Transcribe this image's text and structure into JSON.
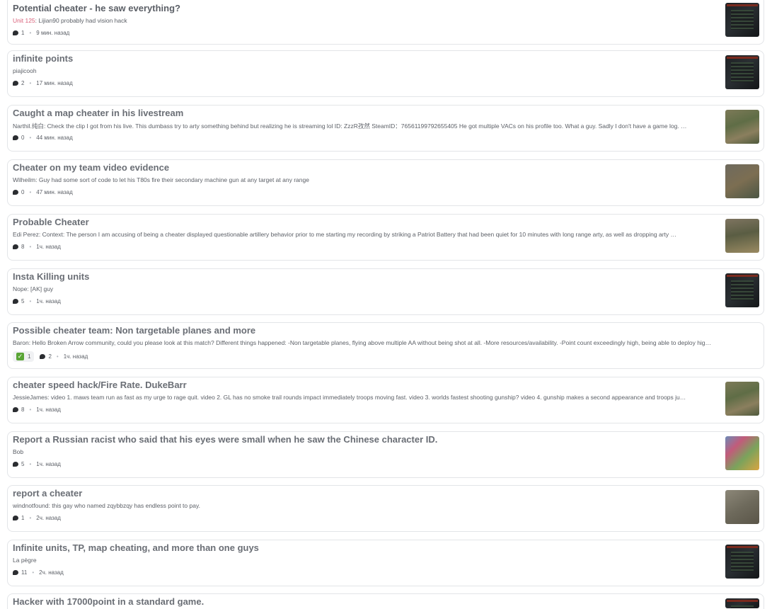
{
  "posts": [
    {
      "title": "Potential cheater - he saw everything?",
      "author": "Unit 125",
      "text": ": Lijian90 probably had vision hack",
      "comments": "1",
      "time": "9 мин. назад"
    },
    {
      "title": "infinite points",
      "author": "piajicooh",
      "text": "",
      "comments": "2",
      "time": "17 мин. назад"
    },
    {
      "title": "Caught a map cheater in his livestream",
      "author": "Narthil.纯白",
      "text": ": Check the clip I got from his live. This dumbass try to arty something behind but realizing he is streaming lol ID: ZzzR孜然 SteamID：76561199792655405 He got multiple VACs on his profile too. What a guy. Sadly I don't have a game log. …",
      "comments": "0",
      "time": "44 мин. назад"
    },
    {
      "title": "Cheater on my team video evidence",
      "author": "Wilheilm",
      "text": ": Guy had some sort of code to let his T80s fire their secondary machine gun at any target at any range",
      "comments": "0",
      "time": "47 мин. назад"
    },
    {
      "title": "Probable Cheater",
      "author": "Edi Perez",
      "text": ": Context: The person I am accusing of being a cheater displayed questionable artillery behavior prior to me starting my recording by striking a Patriot Battery that had been quiet for 10 minutes with long range arty, as well as dropping arty …",
      "comments": "8",
      "time": "1ч. назад"
    },
    {
      "title": "Insta Killing units",
      "author": "Nope",
      "text": ": [AK] guy",
      "comments": "5",
      "time": "1ч. назад"
    },
    {
      "title": "Possible cheater team: Non targetable planes and more",
      "author": "Baron",
      "text": ": Hello Broken Arrow community, could you please look at this match? Different things happened: -Non targetable planes, flying above multiple AA without being shot at all. -More resources/availability. -Point count exceedingly high, being able to deploy hig…",
      "reaction": "1",
      "comments": "2",
      "time": "1ч. назад"
    },
    {
      "title": "cheater speed hack/Fire Rate. DukeBarr",
      "author": "JessieJames",
      "text": ": video 1. maws team run as fast as my urge to rage quit. video 2. GL has no smoke trail rounds impact immediately troops moving fast. video 3. worlds fastest shooting gunship? video 4. gunship makes a second appearance and troops ju…",
      "comments": "8",
      "time": "1ч. назад"
    },
    {
      "title": "Report a Russian racist who said that his eyes were small when he saw the Chinese character ID.",
      "author": "Bob",
      "text": "",
      "comments": "5",
      "time": "1ч. назад"
    },
    {
      "title": "report a cheater",
      "author": "windnotfound",
      "text": ": this gay who named zqybbzqy has endless point to pay.",
      "comments": "1",
      "time": "2ч. назад"
    },
    {
      "title": "Infinite units, TP, map cheating, and more than one guys",
      "author": "La pègre",
      "text": "",
      "comments": "11",
      "time": "2ч. назад"
    },
    {
      "title": "Hacker with 17000point in a standard game.",
      "author": "",
      "text": "",
      "comments": "",
      "time": ""
    }
  ]
}
